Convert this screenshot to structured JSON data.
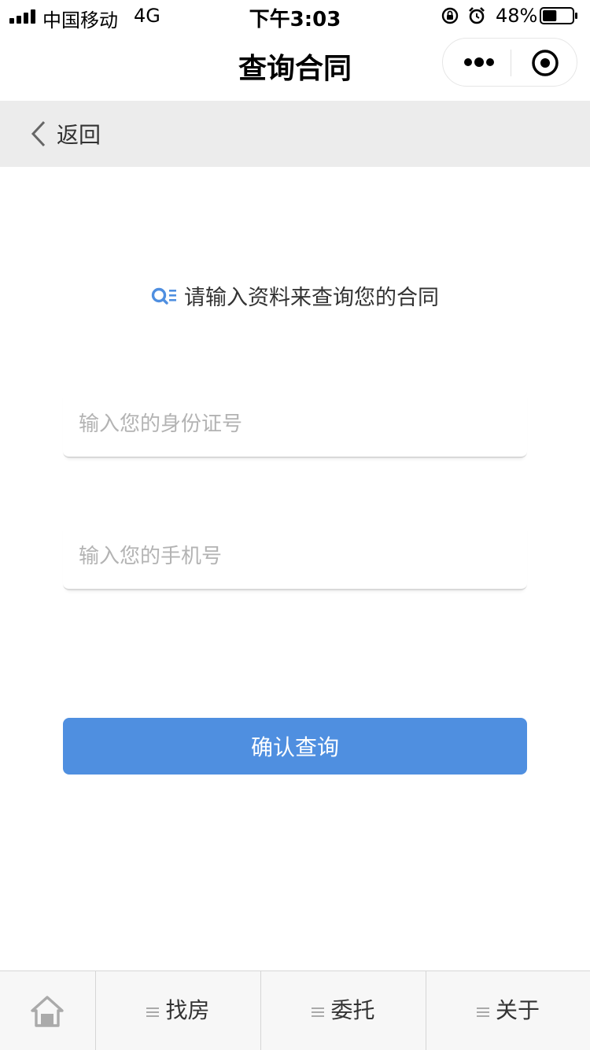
{
  "status_bar": {
    "carrier": "中国移动",
    "network": "4G",
    "time": "下午3:03",
    "battery": "48%",
    "battery_level": 0.48,
    "icons": [
      "signal-icon",
      "rotation-lock-icon",
      "alarm-icon",
      "battery-icon"
    ]
  },
  "nav": {
    "title": "查询合同",
    "icons": [
      "more-icon",
      "close-mini-program-icon"
    ]
  },
  "back": {
    "label": "返回",
    "icon": "chevron-left-icon"
  },
  "form": {
    "prompt": "请输入资料来查询您的合同",
    "prompt_icon": "search-list-icon",
    "id_placeholder": "输入您的身份证号",
    "id_value": "",
    "phone_placeholder": "输入您的手机号",
    "phone_value": "",
    "submit_label": "确认查询"
  },
  "tabs": [
    {
      "label": "",
      "icon": "home-icon"
    },
    {
      "label": "找房",
      "icon": "menu-icon"
    },
    {
      "label": "委托",
      "icon": "menu-icon"
    },
    {
      "label": "关于",
      "icon": "menu-icon"
    }
  ],
  "colors": {
    "accent": "#4f8fe0",
    "back_bar_bg": "#ececec",
    "tab_bar_bg": "#f7f7f7"
  }
}
